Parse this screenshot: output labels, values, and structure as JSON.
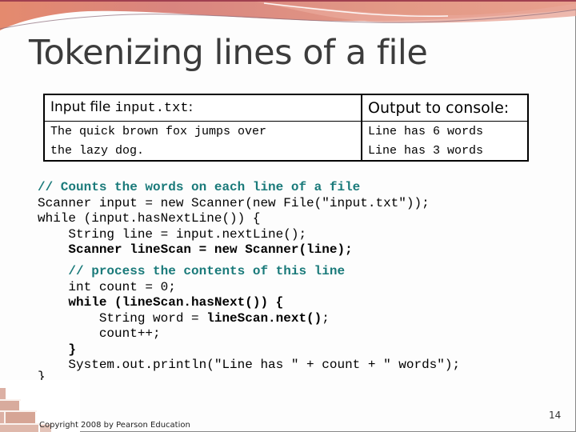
{
  "slide": {
    "title": "Tokenizing lines of a file",
    "page_number": "14",
    "copyright": "Copyright 2008 by Pearson Education"
  },
  "io_table": {
    "input_header_label": "Input file ",
    "input_header_filename": "input.txt",
    "input_header_suffix": ":",
    "output_header": "Output to console:",
    "input_lines": [
      "The quick brown fox jumps over",
      "the lazy dog."
    ],
    "output_lines": [
      "Line has 6 words",
      "Line has 3 words"
    ]
  },
  "code": {
    "lines": [
      {
        "segments": [
          {
            "text": "// Counts the words on each line of a file",
            "style": "comment"
          }
        ]
      },
      {
        "segments": [
          {
            "text": "Scanner input = new Scanner(new File(\"input.txt\"));",
            "style": "normal"
          }
        ]
      },
      {
        "segments": [
          {
            "text": "while (input.hasNextLine()) {",
            "style": "normal"
          }
        ]
      },
      {
        "segments": [
          {
            "text": "    String line = input.nextLine();",
            "style": "normal"
          }
        ]
      },
      {
        "segments": [
          {
            "text": "    Scanner lineScan = new Scanner(line);",
            "style": "bold"
          }
        ]
      },
      {
        "segments": [
          {
            "text": "    // process the contents of this line",
            "style": "comment"
          }
        ]
      },
      {
        "segments": [
          {
            "text": "    int count = 0;",
            "style": "normal"
          }
        ]
      },
      {
        "segments": [
          {
            "text": "    while (lineScan.hasNext()) {",
            "style": "bold"
          }
        ]
      },
      {
        "segments": [
          {
            "text": "        String word = ",
            "style": "normal"
          },
          {
            "text": "lineScan.next()",
            "style": "bold"
          },
          {
            "text": ";",
            "style": "normal"
          }
        ]
      },
      {
        "segments": [
          {
            "text": "        count++;",
            "style": "normal"
          }
        ]
      },
      {
        "segments": [
          {
            "text": "    }",
            "style": "bold"
          }
        ]
      },
      {
        "segments": [
          {
            "text": "    System.out.println(\"Line has \" + count + \" words\");",
            "style": "normal"
          }
        ]
      },
      {
        "segments": [
          {
            "text": "}",
            "style": "normal"
          }
        ]
      }
    ]
  },
  "colors": {
    "comment": "#1a7a7a",
    "title": "#3c3c3c",
    "header_band": "#d9807a"
  }
}
